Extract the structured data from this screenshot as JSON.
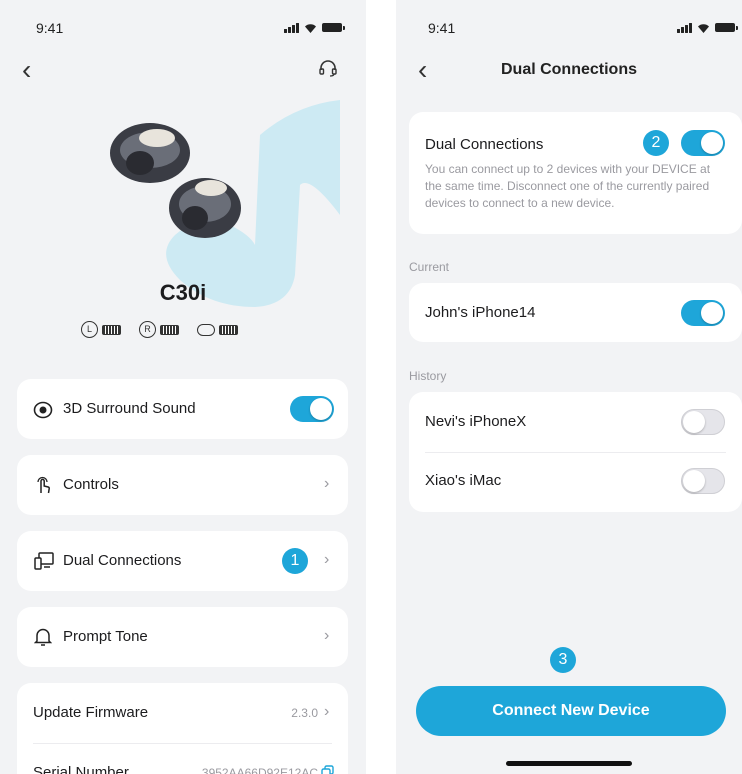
{
  "left": {
    "status_time": "9:41",
    "product_name": "C30i",
    "batteries": [
      {
        "letter": "L"
      },
      {
        "letter": "R"
      },
      {
        "letter": ""
      }
    ],
    "menu": {
      "surround_label": "3D Surround Sound",
      "surround_on": true,
      "controls_label": "Controls",
      "dual_label": "Dual Connections",
      "dual_badge": "1",
      "prompt_label": "Prompt Tone",
      "firmware_label": "Update Firmware",
      "firmware_version": "2.3.0",
      "serial_label": "Serial Number",
      "serial_value": "3952AA66D92E12AC"
    }
  },
  "right": {
    "status_time": "9:41",
    "title": "Dual Connections",
    "dual": {
      "title": "Dual Connections",
      "badge": "2",
      "on": true,
      "description": "You can connect up to 2 devices with your DEVICE at the same time. Disconnect one of the currently paired devices to connect to a new device."
    },
    "current_label": "Current",
    "current_devices": [
      {
        "name": "John's iPhone14",
        "connected": true
      }
    ],
    "history_label": "History",
    "history_devices": [
      {
        "name": "Nevi's iPhoneX",
        "connected": false
      },
      {
        "name": "Xiao's iMac",
        "connected": false
      }
    ],
    "step_badge": "3",
    "connect_button": "Connect New Device"
  },
  "colors": {
    "accent": "#1ea6d9",
    "background": "#f2f3f5",
    "card": "#ffffff",
    "secondary_text": "#9a9aa0"
  }
}
